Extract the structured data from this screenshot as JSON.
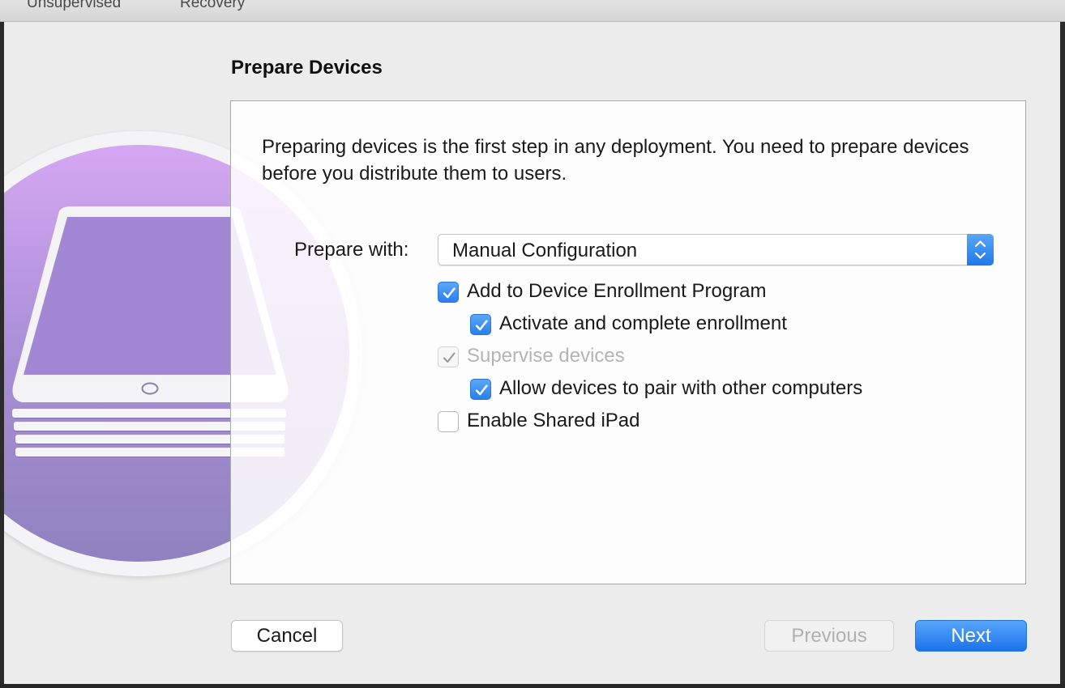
{
  "toolbar": {
    "tabs": [
      {
        "label": "Unsupervised"
      },
      {
        "label": "Recovery"
      }
    ]
  },
  "sheet": {
    "title": "Prepare Devices",
    "description": "Preparing devices is the first step in any deployment. You need to prepare devices before you distribute them to users.",
    "prepare_with_label": "Prepare with:",
    "prepare_with_value": "Manual Configuration",
    "options": [
      {
        "label": "Add to Device Enrollment Program",
        "checked": true,
        "enabled": true
      },
      {
        "label": "Activate and complete enrollment",
        "checked": true,
        "enabled": true
      },
      {
        "label": "Supervise devices",
        "checked": true,
        "enabled": false
      },
      {
        "label": "Allow devices to pair with other computers",
        "checked": true,
        "enabled": true
      },
      {
        "label": "Enable Shared iPad",
        "checked": false,
        "enabled": true
      }
    ]
  },
  "buttons": {
    "cancel": "Cancel",
    "previous": "Previous",
    "next": "Next"
  },
  "colors": {
    "accent": "#1f78ea",
    "disc_top": "#d5a7f2",
    "disc_bottom": "#8f82bf"
  },
  "icons": {
    "popup": "up-down-arrows-icon",
    "illustration": "ipad-stack-icon",
    "check": "checkmark-icon"
  }
}
